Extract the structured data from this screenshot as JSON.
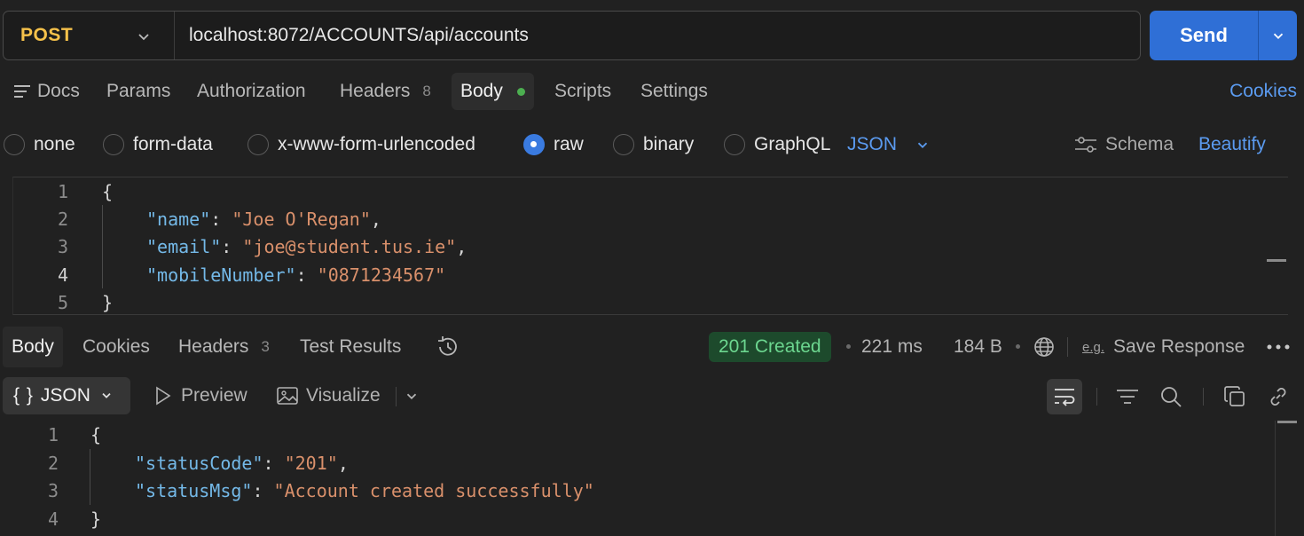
{
  "request": {
    "method": "POST",
    "url": "localhost:8072/ACCOUNTS/api/accounts",
    "send_label": "Send"
  },
  "request_tabs": {
    "docs": "Docs",
    "params": "Params",
    "authorization": "Authorization",
    "headers": "Headers",
    "headers_count": "8",
    "body": "Body",
    "scripts": "Scripts",
    "settings": "Settings",
    "cookies": "Cookies"
  },
  "body_types": {
    "none": "none",
    "form_data": "form-data",
    "urlencoded": "x-www-form-urlencoded",
    "raw": "raw",
    "binary": "binary",
    "graphql": "GraphQL",
    "selected": "raw",
    "language": "JSON",
    "schema": "Schema",
    "beautify": "Beautify"
  },
  "request_body": {
    "line_numbers": [
      "1",
      "2",
      "3",
      "4",
      "5"
    ],
    "open_brace": "{",
    "close_brace": "}",
    "fields": [
      {
        "key": "\"name\"",
        "value": "\"Joe O'Regan\"",
        "trail": ","
      },
      {
        "key": "\"email\"",
        "value": "\"joe@student.tus.ie\"",
        "trail": ","
      },
      {
        "key": "\"mobileNumber\"",
        "value": "\"0871234567\"",
        "trail": ""
      }
    ]
  },
  "response_tabs": {
    "body": "Body",
    "cookies": "Cookies",
    "headers": "Headers",
    "headers_count": "3",
    "test_results": "Test Results"
  },
  "response_meta": {
    "status": "201 Created",
    "time": "221 ms",
    "size": "184 B",
    "save_response": "Save Response",
    "eg_label": "e.g."
  },
  "response_toolbar": {
    "format": "JSON",
    "format_glyph": "{ }",
    "preview": "Preview",
    "visualize": "Visualize"
  },
  "response_body": {
    "line_numbers": [
      "1",
      "2",
      "3",
      "4"
    ],
    "open_brace": "{",
    "close_brace": "}",
    "fields": [
      {
        "key": "\"statusCode\"",
        "value": "\"201\"",
        "trail": ","
      },
      {
        "key": "\"statusMsg\"",
        "value": "\"Account created successfully\"",
        "trail": ""
      }
    ]
  },
  "colors": {
    "accent": "#2f6fd6",
    "method": "#f5c14a",
    "status_bg": "#1d4a2c",
    "status_fg": "#6cd68f",
    "json_key": "#74b9e8",
    "json_string": "#d9906b"
  }
}
